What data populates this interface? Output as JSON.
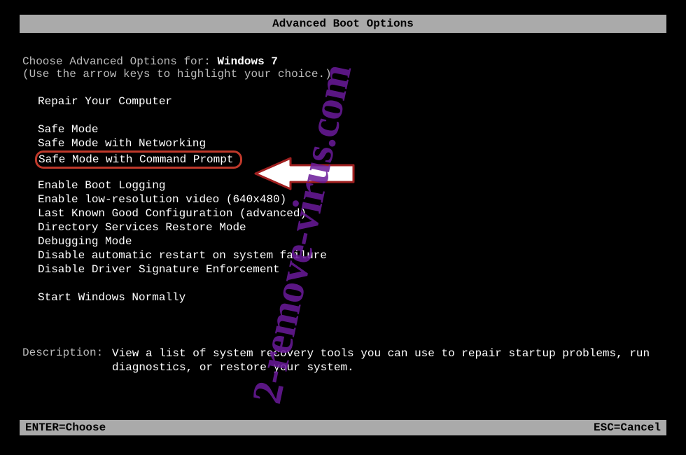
{
  "title": "Advanced Boot Options",
  "intro": {
    "prefix": "Choose Advanced Options for: ",
    "osname": "Windows 7"
  },
  "hint": "(Use the arrow keys to highlight your choice.)",
  "groups": [
    {
      "items": [
        "Repair Your Computer"
      ]
    },
    {
      "items": [
        "Safe Mode",
        "Safe Mode with Networking",
        "Safe Mode with Command Prompt"
      ]
    },
    {
      "items": [
        "Enable Boot Logging",
        "Enable low-resolution video (640x480)",
        "Last Known Good Configuration (advanced)",
        "Directory Services Restore Mode",
        "Debugging Mode",
        "Disable automatic restart on system failure",
        "Disable Driver Signature Enforcement"
      ]
    },
    {
      "items": [
        "Start Windows Normally"
      ]
    }
  ],
  "highlighted_item": "Safe Mode with Command Prompt",
  "description": {
    "label": "Description:",
    "text": "View a list of system recovery tools you can use to repair startup problems, run diagnostics, or restore your system."
  },
  "footer": {
    "left": "ENTER=Choose",
    "right": "ESC=Cancel"
  },
  "watermark": "2-remove-virus.com"
}
